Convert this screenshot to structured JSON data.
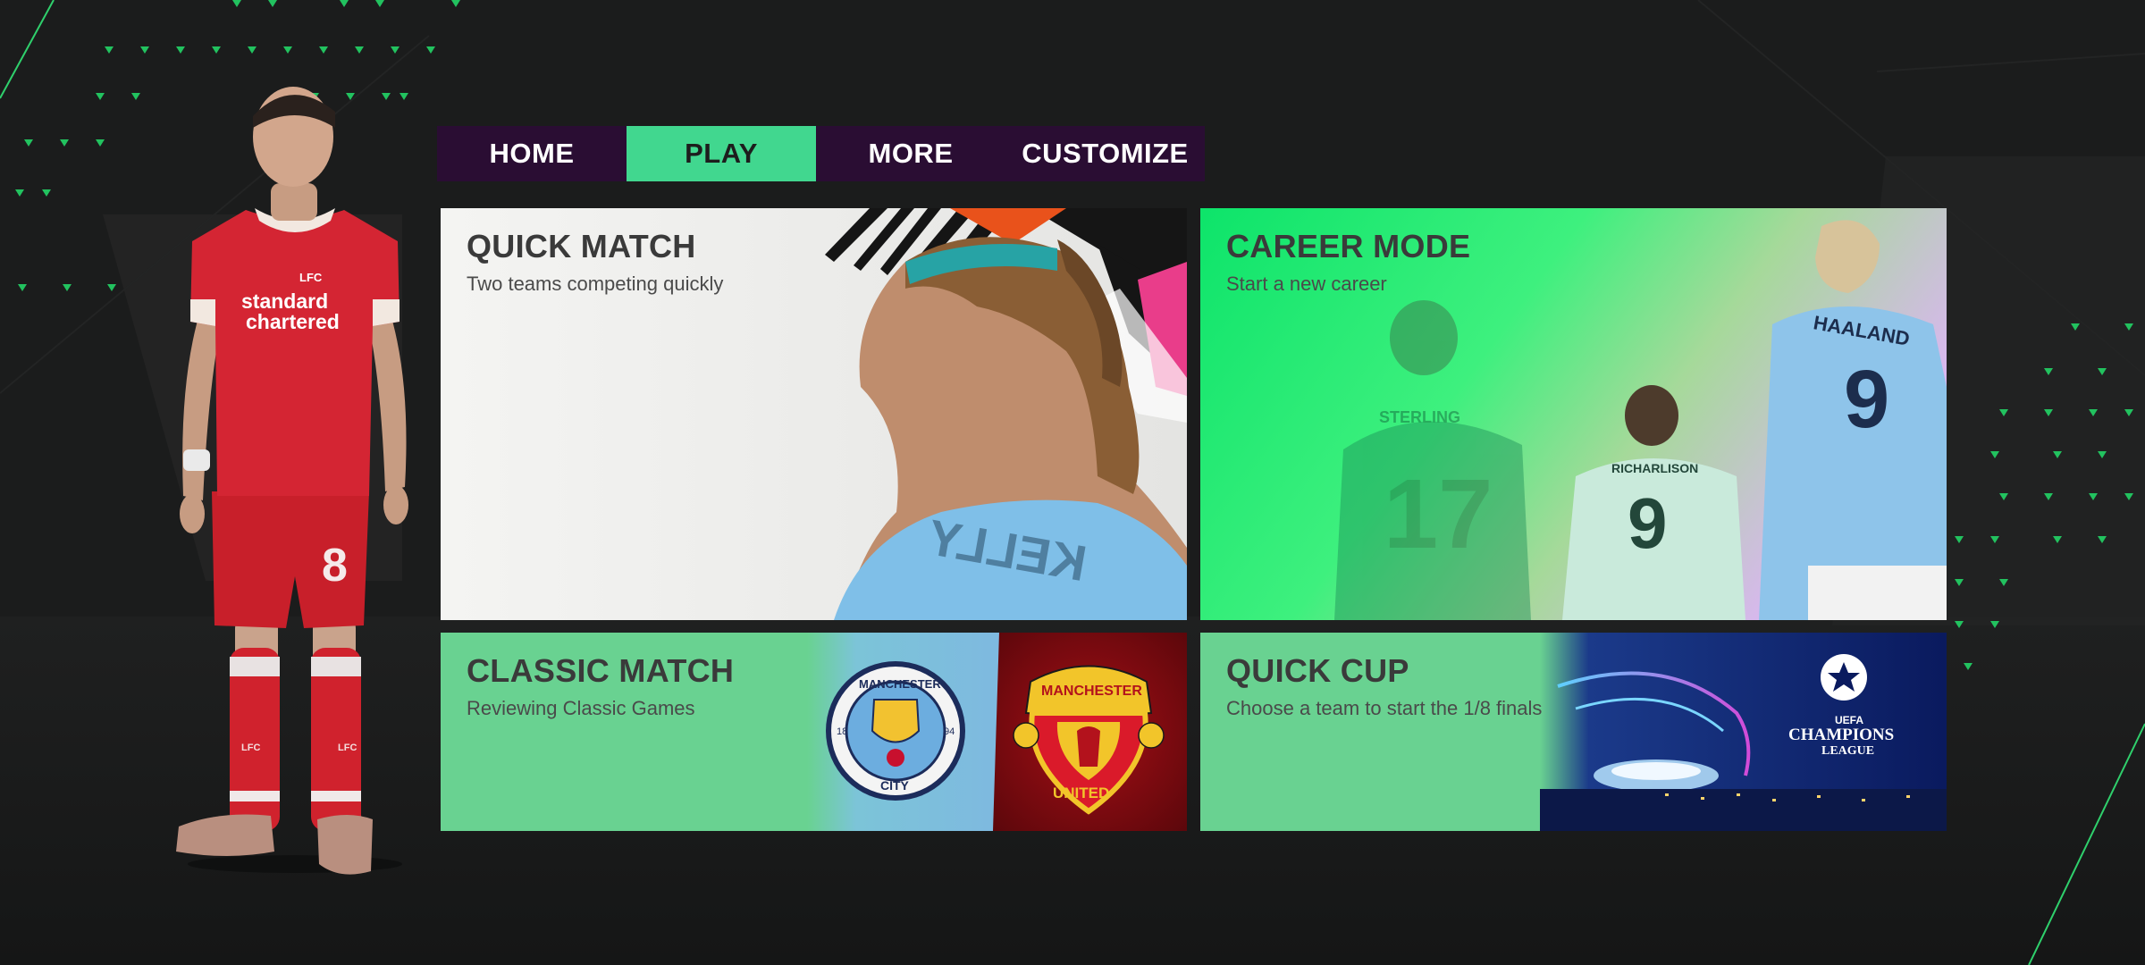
{
  "nav": {
    "tabs": [
      {
        "label": "HOME",
        "active": false
      },
      {
        "label": "PLAY",
        "active": true
      },
      {
        "label": "MORE",
        "active": false
      },
      {
        "label": "CUSTOMIZE",
        "active": false
      }
    ]
  },
  "cards": {
    "quick_match": {
      "title": "QUICK MATCH",
      "subtitle": "Two teams competing quickly",
      "shirt_text": "KELLY"
    },
    "career_mode": {
      "title": "CAREER MODE",
      "subtitle": "Start a new career",
      "shirt_left": "17",
      "shirt_left_name": "STERLING",
      "shirt_mid": "9",
      "shirt_mid_name": "RICHARLISON",
      "shirt_right": "9",
      "shirt_right_name": "HAALAND"
    },
    "classic_match": {
      "title": "CLASSIC MATCH",
      "subtitle": "Reviewing Classic Games",
      "crest_left_top": "MANCHESTER",
      "crest_left_bottom": "CITY",
      "crest_left_year_l": "18",
      "crest_left_year_r": "94",
      "crest_right_top": "MANCHESTER",
      "crest_right_bottom": "UNITED"
    },
    "quick_cup": {
      "title": "QUICK CUP",
      "subtitle": "Choose a team to start the 1/8 finals",
      "logo_line1": "UEFA",
      "logo_line2": "CHAMPIONS",
      "logo_line3": "LEAGUE"
    }
  },
  "player": {
    "sponsor_line1": "standard",
    "sponsor_line2": "chartered",
    "club_crest": "LFC",
    "number": "8",
    "sock_left": "LFC",
    "sock_right": "LFC"
  },
  "colors": {
    "background": "#1a1b1b",
    "nav_bg": "#2a0d33",
    "accent_green": "#41d78f",
    "card_green": "#69d291",
    "career_green": "#0fe86a"
  }
}
